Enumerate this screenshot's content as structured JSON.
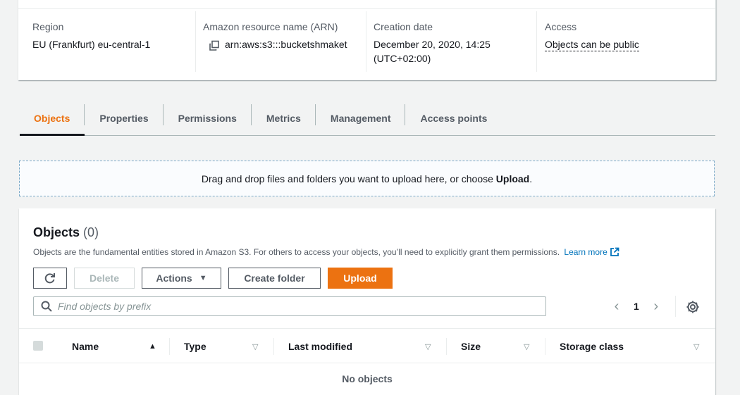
{
  "summary": {
    "region": {
      "label": "Region",
      "value": "EU (Frankfurt) eu-central-1"
    },
    "arn": {
      "label": "Amazon resource name (ARN)",
      "value": "arn:aws:s3:::bucketshmaket",
      "icon": "copy-icon"
    },
    "creation_date": {
      "label": "Creation date",
      "value_line1": "December 20, 2020, 14:25",
      "value_line2": "(UTC+02:00)"
    },
    "access": {
      "label": "Access",
      "value": "Objects can be public"
    }
  },
  "tabs": [
    {
      "label": "Objects",
      "active": true
    },
    {
      "label": "Properties",
      "active": false
    },
    {
      "label": "Permissions",
      "active": false
    },
    {
      "label": "Metrics",
      "active": false
    },
    {
      "label": "Management",
      "active": false
    },
    {
      "label": "Access points",
      "active": false
    }
  ],
  "dropzone": {
    "text": "Drag and drop files and folders you want to upload here, or choose ",
    "bold": "Upload",
    "suffix": "."
  },
  "objects_panel": {
    "title": "Objects",
    "count": "(0)",
    "description": "Objects are the fundamental entities stored in Amazon S3. For others to access your objects, you’ll need to explicitly grant them permissions.",
    "learn_more": "Learn more",
    "buttons": {
      "refresh_icon": "refresh-icon",
      "delete": "Delete",
      "actions": "Actions",
      "create_folder": "Create folder",
      "upload": "Upload"
    },
    "search_placeholder": "Find objects by prefix",
    "pagination": {
      "current_page": "1"
    },
    "columns": [
      "Name",
      "Type",
      "Last modified",
      "Size",
      "Storage class"
    ],
    "empty_text": "No objects"
  },
  "colors": {
    "accent": "#ec7211",
    "link": "#0073bb",
    "text": "#16191f",
    "muted": "#545b64"
  }
}
